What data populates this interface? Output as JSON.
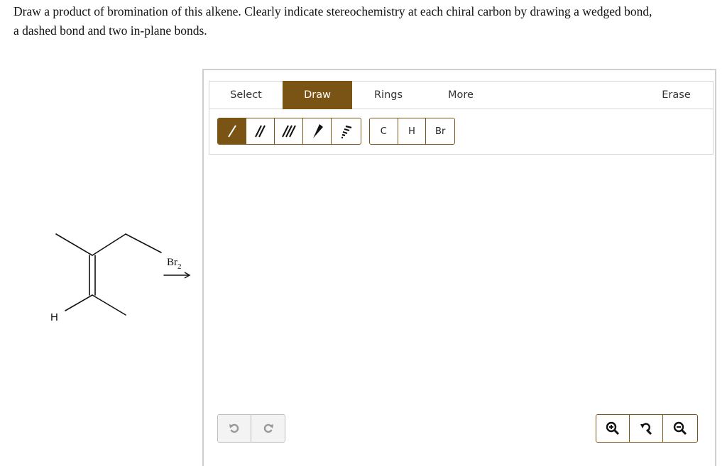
{
  "question": {
    "line1": "Draw a product of bromination of this alkene. Clearly indicate stereochemistry at each chiral carbon by drawing a wedged bond,",
    "line2": "a dashed bond and two in-plane bonds."
  },
  "scheme": {
    "atom_h": "H",
    "reagent_main": "Br",
    "reagent_sub": "2"
  },
  "tabs": {
    "select": "Select",
    "draw": "Draw",
    "rings": "Rings",
    "more": "More",
    "erase": "Erase"
  },
  "atoms": [
    "C",
    "H",
    "Br"
  ],
  "colors": {
    "accent": "#7a5414",
    "border": "#d6d6d6"
  },
  "icons": {
    "bond_tools": [
      "single-bond-icon",
      "double-bond-icon",
      "triple-bond-icon",
      "wedge-bond-icon",
      "dash-bond-icon"
    ],
    "history": [
      "undo-icon",
      "redo-icon"
    ],
    "zoom": [
      "zoom-in-icon",
      "zoom-reset-icon",
      "zoom-out-icon"
    ]
  }
}
